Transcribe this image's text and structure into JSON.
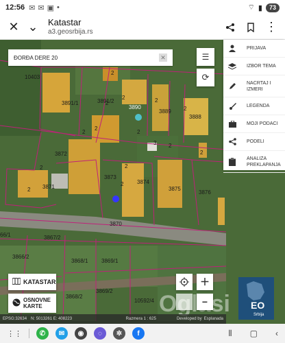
{
  "status_bar": {
    "time": "12:56",
    "battery": "73"
  },
  "browser": {
    "title": "Katastar",
    "url": "a3.geosrbija.rs"
  },
  "search": {
    "value": "ĐORĐA DERE 20"
  },
  "menu": {
    "items": [
      {
        "label": "PRIJAVA",
        "icon": "user-icon"
      },
      {
        "label": "IZBOR TEMA",
        "icon": "layers-icon"
      },
      {
        "label": "NACRTAJ I IZMERI",
        "icon": "pencil-icon"
      },
      {
        "label": "LEGENDA",
        "icon": "brush-icon"
      },
      {
        "label": "MOJI PODACI",
        "icon": "briefcase-icon"
      },
      {
        "label": "PODELI",
        "icon": "share-icon"
      },
      {
        "label": "ANALIZA PREKLAPANJA",
        "icon": "clipboard-icon"
      }
    ]
  },
  "buttons": {
    "katastar": "KATASTAR",
    "osnovne_karte": "OSNOVNE KARTE"
  },
  "footer": {
    "epsg": "EPSG:32634",
    "coords": "N: 5013261 E: 408223",
    "scale": "Razmera 1 : 625",
    "developed": "Developed by",
    "developer": "Esplanada"
  },
  "logo": {
    "text": "EO",
    "subtext": "Srbija"
  },
  "watermark": "Oglasi",
  "parcels": [
    "10403",
    "3891/1",
    "3891/2",
    "3890",
    "3889",
    "3888",
    "3872",
    "3873",
    "3874",
    "3875",
    "3876",
    "3871",
    "3870",
    "3867/2",
    "3866/2",
    "3868/1",
    "3869/1",
    "3868/2",
    "3869/2",
    "10592/4",
    "66/1"
  ],
  "small_numbers": [
    "2",
    "2",
    "2",
    "2",
    "2",
    "2",
    "2",
    "2",
    "3",
    "2",
    "2",
    "2",
    "2",
    "2",
    "2"
  ]
}
